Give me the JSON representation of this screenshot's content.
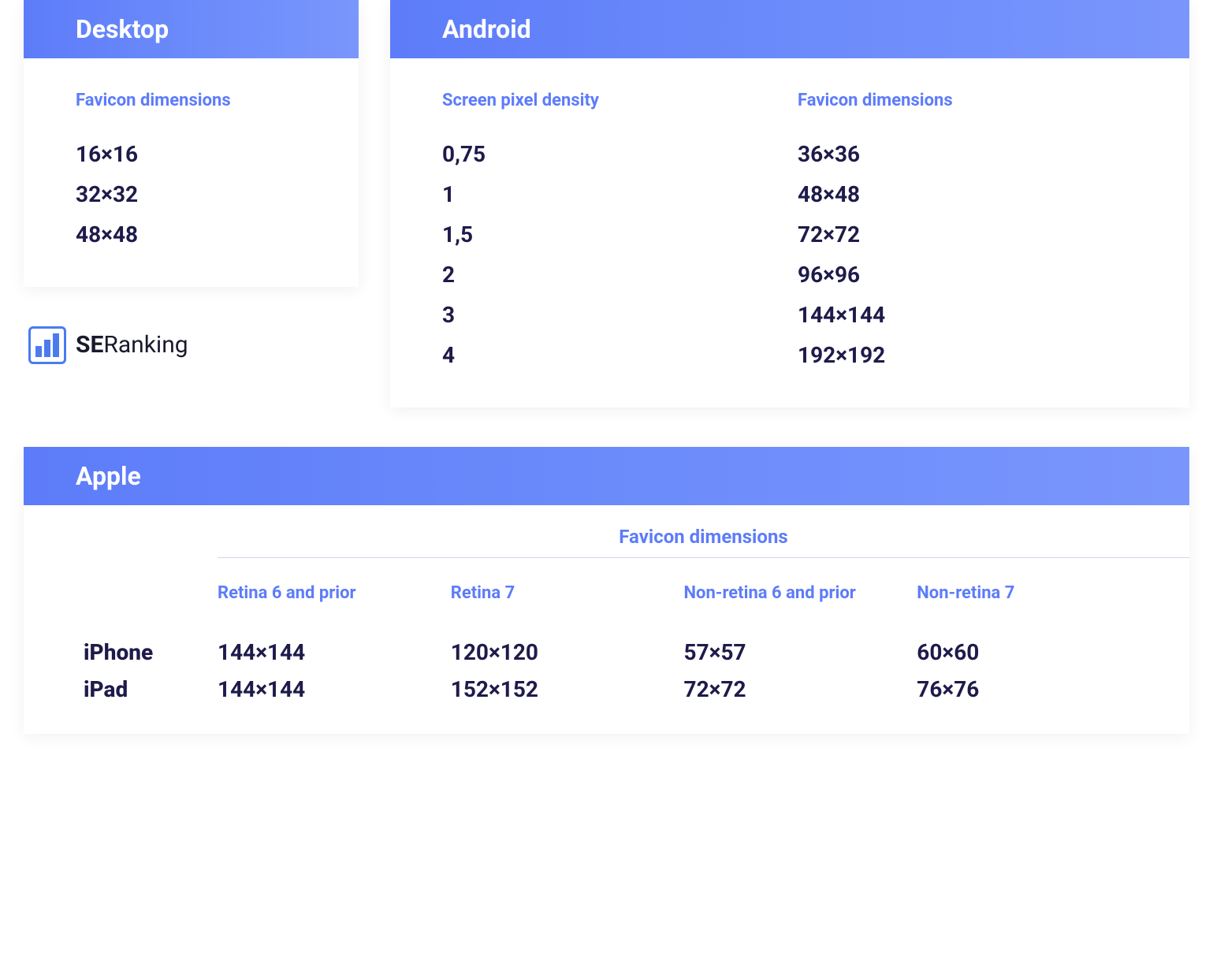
{
  "desktop": {
    "title": "Desktop",
    "col_header": "Favicon dimensions",
    "values": [
      "16×16",
      "32×32",
      "48×48"
    ]
  },
  "android": {
    "title": "Android",
    "col1_header": "Screen pixel density",
    "col2_header": "Favicon dimensions",
    "rows": [
      {
        "density": "0,75",
        "dim": "36×36"
      },
      {
        "density": "1",
        "dim": "48×48"
      },
      {
        "density": "1,5",
        "dim": "72×72"
      },
      {
        "density": "2",
        "dim": "96×96"
      },
      {
        "density": "3",
        "dim": "144×144"
      },
      {
        "density": "4",
        "dim": "192×192"
      }
    ]
  },
  "apple": {
    "title": "Apple",
    "top_header": "Favicon dimensions",
    "col_headers": [
      "Retina 6 and prior",
      "Retina 7",
      "Non-retina 6 and prior",
      "Non-retina 7"
    ],
    "rows": [
      {
        "label": "iPhone",
        "values": [
          "144×144",
          "120×120",
          "57×57",
          "60×60"
        ]
      },
      {
        "label": "iPad",
        "values": [
          "144×144",
          "152×152",
          "72×72",
          "76×76"
        ]
      }
    ]
  },
  "logo": {
    "bold": "SE",
    "light": "Ranking"
  }
}
